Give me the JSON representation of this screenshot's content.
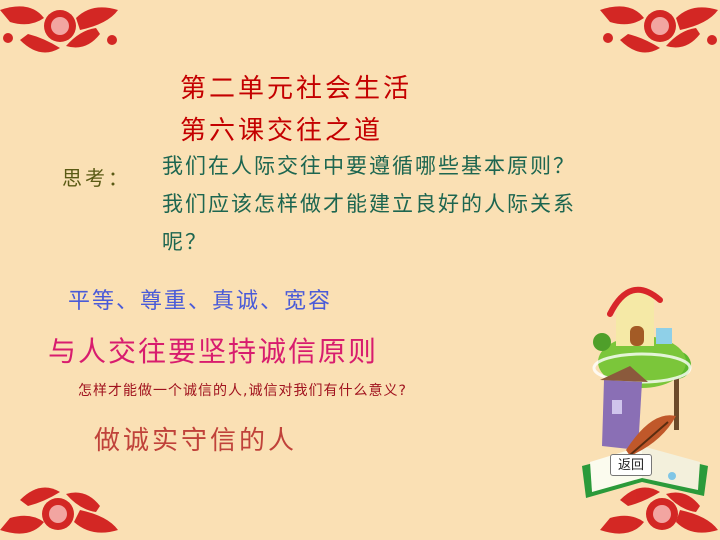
{
  "slide": {
    "title_line1": "第二单元社会生活",
    "title_line2": "第六课交往之道",
    "label": "思考：",
    "body_lines": [
      "我们在人际交往中要遵循哪些基本原则？",
      "我们应该怎样做才能建立良好的人际关系",
      "呢？"
    ],
    "blue_line": "平等、尊重、真诚、宽容",
    "pink_line": "与人交往要坚持诚信原则",
    "question": "怎样才能做一个诚信的人,诚信对我们有什么意义?",
    "answer": "做诚实守信的人"
  },
  "nav": {
    "back_label": "返回"
  },
  "colors": {
    "background": "#fae0b4",
    "title": "#c40000",
    "body": "#1d6650",
    "accent_blue": "#4a5bd8",
    "accent_pink": "#d81c6e"
  },
  "icons": [
    "paper-cut-flower-icon",
    "house-book-clipart"
  ]
}
